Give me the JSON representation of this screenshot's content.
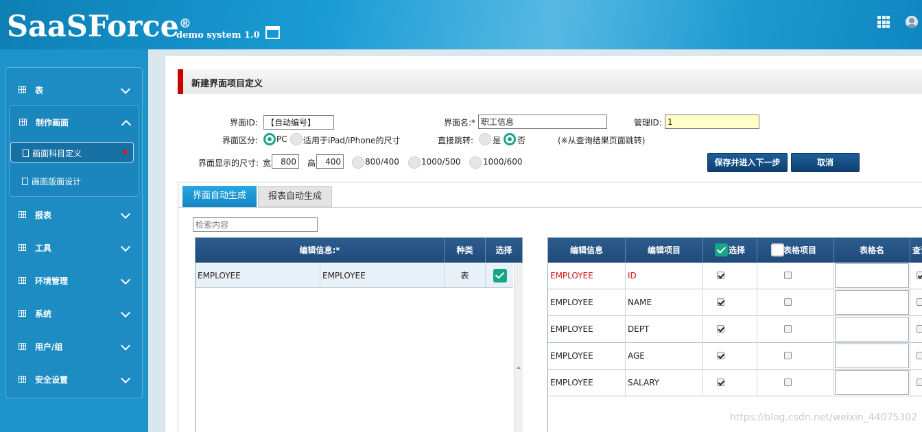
{
  "header": {
    "logo": "SaaSForce",
    "registered": "®",
    "version": "demo system 1.0"
  },
  "sidebar": {
    "items": [
      {
        "label": "表"
      },
      {
        "label": "制作画面"
      },
      {
        "label": "报表"
      },
      {
        "label": "工具"
      },
      {
        "label": "环境管理"
      },
      {
        "label": "系统"
      },
      {
        "label": "用户/组"
      },
      {
        "label": "安全设置"
      }
    ],
    "sub_items": [
      {
        "label": "画面科目定义",
        "active": true
      },
      {
        "label": "画面版面设计",
        "active": false
      }
    ]
  },
  "page": {
    "title": "新建界面项目定义"
  },
  "form": {
    "screen_id_label": "界面ID:",
    "screen_id_value": "【自动编号】",
    "screen_name_label": "界面名:*",
    "screen_name_value": "职工信息",
    "manage_id_label": "管理ID:",
    "manage_id_value": "1",
    "category_label": "界面区分:",
    "category_pc": "PC",
    "category_ipad": "适用于iPad/iPhone的尺寸",
    "jump_label": "直接跳转:",
    "jump_yes": "是",
    "jump_no": "否",
    "jump_note": "(※从查询结果页面跳转)",
    "size_label": "界面显示的尺寸:",
    "width_label": "宽",
    "width_value": "800",
    "height_label": "高",
    "height_value": "400",
    "size_options": [
      "800/400",
      "1000/500",
      "1000/600"
    ],
    "save_button": "保存并进入下一步",
    "cancel_button": "取消"
  },
  "tabs": [
    {
      "label": "界面自动生成",
      "active": true
    },
    {
      "label": "报表自动生成",
      "active": false
    }
  ],
  "search": {
    "placeholder": "检索内容"
  },
  "left_table": {
    "headers": [
      "编辑信息:*",
      "种类",
      "选择"
    ],
    "rows": [
      {
        "col1": "EMPLOYEE",
        "col2": "EMPLOYEE",
        "type": "表",
        "selected": true
      }
    ]
  },
  "right_table": {
    "headers": [
      "编辑信息",
      "编辑项目",
      "选择",
      "表格项目",
      "表格名",
      "查询条"
    ],
    "rows": [
      {
        "info": "EMPLOYEE",
        "item": "ID",
        "select": true,
        "table_item": false,
        "search": true,
        "highlight": true
      },
      {
        "info": "EMPLOYEE",
        "item": "NAME",
        "select": true,
        "table_item": false,
        "search": false,
        "highlight": false
      },
      {
        "info": "EMPLOYEE",
        "item": "DEPT",
        "select": true,
        "table_item": false,
        "search": false,
        "highlight": false
      },
      {
        "info": "EMPLOYEE",
        "item": "AGE",
        "select": true,
        "table_item": false,
        "search": false,
        "highlight": false
      },
      {
        "info": "EMPLOYEE",
        "item": "SALARY",
        "select": true,
        "table_item": false,
        "search": false,
        "highlight": false
      }
    ]
  },
  "watermark": "https://blog.csdn.net/weixin_44075302",
  "colors": {
    "brand_blue": "#1d93c9",
    "header_dark": "#1f4b7a",
    "accent_green": "#17a589",
    "title_red": "#cc0000"
  }
}
